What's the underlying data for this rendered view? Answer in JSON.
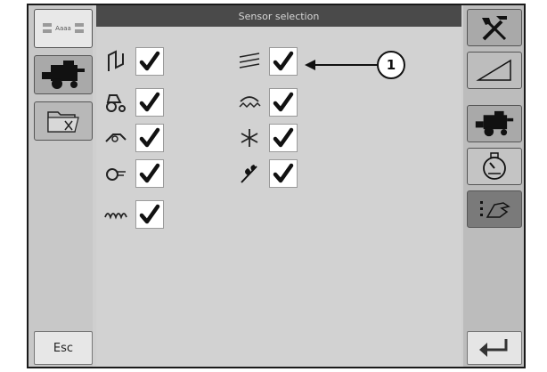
{
  "screen": {
    "title": "Sensor selection"
  },
  "left_buttons": [
    {
      "icon": "page-layout-icon",
      "label": "Aaaa"
    },
    {
      "icon": "combine-harvester-icon"
    },
    {
      "icon": "folder-settings-icon"
    }
  ],
  "right_buttons": [
    {
      "icon": "tools-icon"
    },
    {
      "icon": "ramp-triangle-icon"
    },
    {
      "icon": "combine-harvester-icon"
    },
    {
      "icon": "engine-gauge-icon"
    },
    {
      "icon": "hand-settings-icon"
    }
  ],
  "sensors": [
    {
      "icon": "feeder-sensor-icon",
      "checked": true
    },
    {
      "icon": "straw-walker-sensor-icon",
      "checked": true
    },
    {
      "icon": "tractor-sensor-icon",
      "checked": true
    },
    {
      "icon": "chopper-sensor-icon",
      "checked": true
    },
    {
      "icon": "chain-sensor-icon",
      "checked": true
    },
    {
      "icon": "spreader-sensor-icon",
      "checked": true
    },
    {
      "icon": "rotor-sensor-icon",
      "checked": true
    },
    {
      "icon": "grain-sensor-icon",
      "checked": true
    },
    {
      "icon": "auger-sensor-icon",
      "checked": true
    }
  ],
  "esc_label": "Esc",
  "callout": {
    "label": "1"
  },
  "colors": {
    "title_bar": "#4a4a4a",
    "content": "#d2d2d2",
    "checkbox": "#ffffff"
  }
}
